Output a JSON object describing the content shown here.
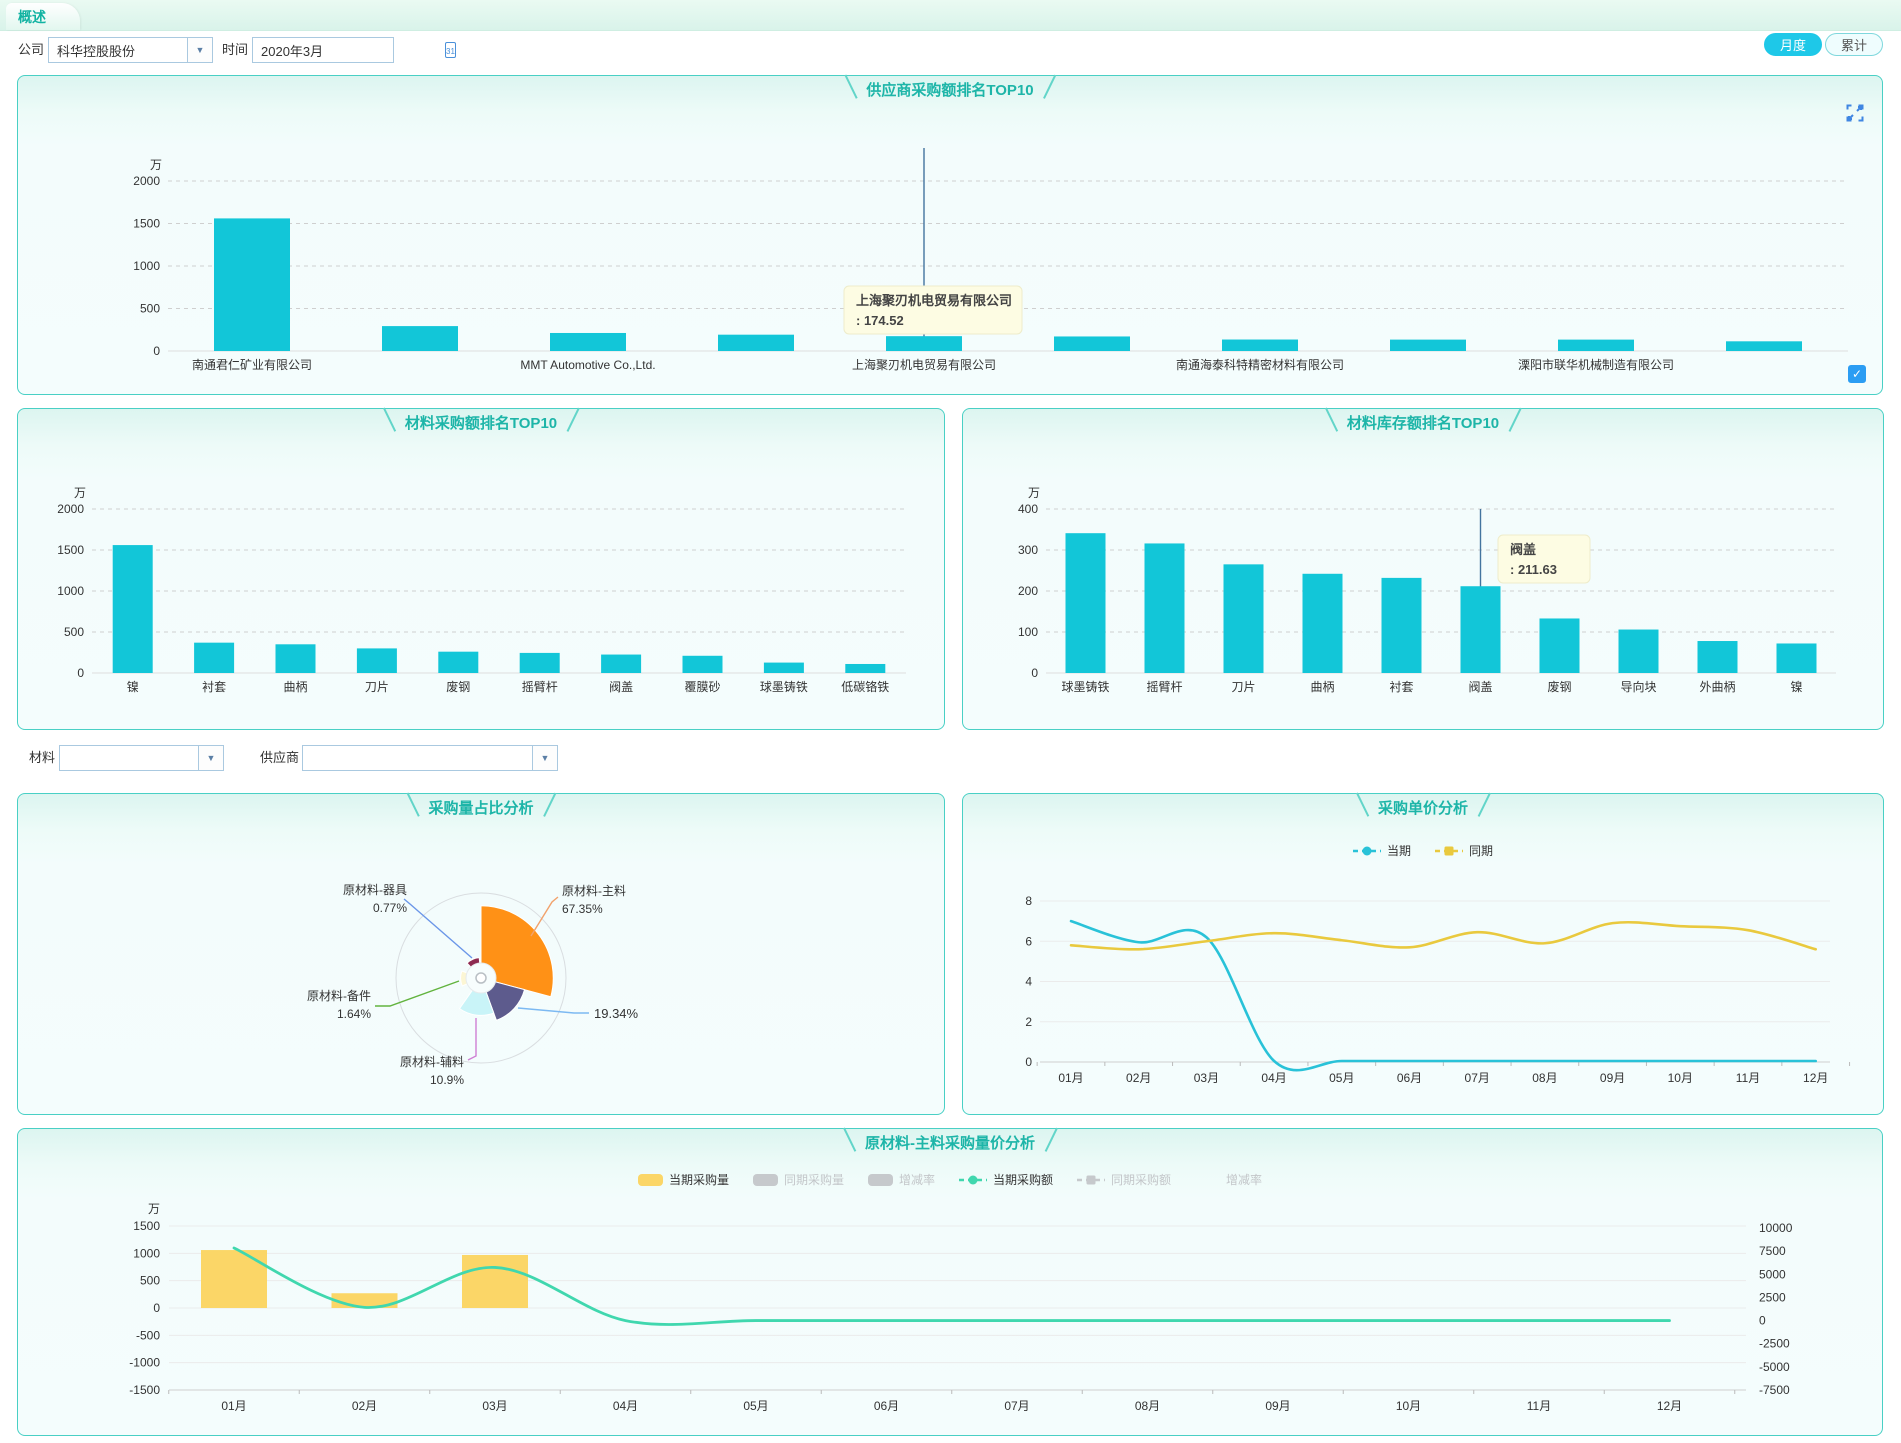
{
  "tab": {
    "label": "概述"
  },
  "filters": {
    "company_label": "公司",
    "company_value": "科华控股股份",
    "time_label": "时间",
    "time_value": "2020年3月",
    "material_label": "材料",
    "material_value": "",
    "supplier_label": "供应商",
    "supplier_value": "",
    "monthly_button": "月度",
    "cumulative_button": "累计"
  },
  "colors": {
    "accent_teal": "#1db5a8",
    "bar_cyan": "#12c6d8",
    "panel_border": "#49d0c5",
    "tooltip_bg": "#fdfce3",
    "axis_pointer": "#43749f",
    "grid_dash": "#cfcfcf",
    "grid_solid": "#ebebeb",
    "axis_text": "#333333",
    "button_active": "#1ec8e8",
    "checkbox_blue": "#2b9df3",
    "expand_blue": "#3f86e2",
    "inactive_gray": "#c6c9cc"
  },
  "chart_data": [
    {
      "id": "supplier_top10",
      "type": "bar",
      "title": "供应商采购额排名TOP10",
      "unit": "万",
      "categories": [
        "南通君仁矿业有限公司",
        "",
        "MMT Automotive Co.,Ltd.",
        "",
        "上海聚刃机电贸易有限公司",
        "",
        "南通海泰科特精密材料有限公司",
        "",
        "溧阳市联华机械制造有限公司",
        ""
      ],
      "values": [
        1560,
        293,
        212,
        192,
        174.52,
        171,
        135,
        134,
        134,
        114
      ],
      "ylim": [
        0,
        2000
      ],
      "ytick_step": 500,
      "grid": "dashed",
      "tooltip": {
        "line1": "上海聚刃机电贸易有限公司",
        "line2": ": 174.52",
        "bar_index": 4
      }
    },
    {
      "id": "material_purchase_top10",
      "type": "bar",
      "title": "材料采购额排名TOP10",
      "unit": "万",
      "categories": [
        "镍",
        "衬套",
        "曲柄",
        "刀片",
        "废钢",
        "摇臂杆",
        "阀盖",
        "覆膜砂",
        "球墨铸铁",
        "低碳铬铁"
      ],
      "values": [
        1560,
        370,
        350,
        300,
        260,
        245,
        225,
        210,
        127,
        110
      ],
      "ylim": [
        0,
        2000
      ],
      "ytick_step": 500,
      "grid": "dashed"
    },
    {
      "id": "material_stock_top10",
      "type": "bar",
      "title": "材料库存额排名TOP10",
      "unit": "万",
      "categories": [
        "球墨铸铁",
        "摇臂杆",
        "刀片",
        "曲柄",
        "衬套",
        "阀盖",
        "废钢",
        "导向块",
        "外曲柄",
        "镍"
      ],
      "values": [
        341,
        316,
        265,
        242,
        232,
        211.63,
        133,
        106,
        78,
        72
      ],
      "ylim": [
        0,
        400
      ],
      "ytick_step": 100,
      "grid": "dashed",
      "tooltip": {
        "line1": "阀盖",
        "line2": ": 211.63",
        "bar_index": 5
      }
    },
    {
      "id": "purchase_qty_share",
      "type": "pie",
      "title": "采购量占比分析",
      "slices": [
        {
          "name": "原材料-主料",
          "pct": "67.35%",
          "color": "#ff9116",
          "line_color": "#f2a26c",
          "start": 0,
          "end": 105,
          "r": 0.85
        },
        {
          "name": "",
          "pct": "19.34%",
          "color": "#5d5b8d",
          "line_color": "#7cb9f2",
          "start": 105,
          "end": 160,
          "r": 0.53
        },
        {
          "name": "原材料-辅料",
          "pct": "10.9%",
          "color": "#c9f4f8",
          "line_color": "#cf7fd4",
          "start": 160,
          "end": 215,
          "r": 0.44
        },
        {
          "name": "原材料-备件",
          "pct": "1.64%",
          "color": "#fcf6d4",
          "line_color": "#62b33e",
          "start": 247,
          "end": 290,
          "r": 0.24
        },
        {
          "name": "原材料-器具",
          "pct": "0.77%",
          "color": "#8e2a50",
          "line_color": "#6b96e8",
          "start": 317,
          "end": 355,
          "r": 0.24
        }
      ]
    },
    {
      "id": "unit_price_analysis",
      "type": "line",
      "title": "采购单价分析",
      "x": [
        "01月",
        "02月",
        "03月",
        "04月",
        "05月",
        "06月",
        "07月",
        "08月",
        "09月",
        "10月",
        "11月",
        "12月"
      ],
      "ylim": [
        0,
        8
      ],
      "ytick_step": 2,
      "legend": [
        {
          "label": "当期",
          "marker": "line-circle",
          "color": "#29c2d8",
          "active": true
        },
        {
          "label": "同期",
          "marker": "line-square",
          "color": "#e9c93e",
          "active": true
        }
      ],
      "series": [
        {
          "name": "当期",
          "color": "#29c2d8",
          "values": [
            7.0,
            5.95,
            6.2,
            0.05,
            0.05,
            0.05,
            0.05,
            0.05,
            0.05,
            0.05,
            0.05,
            0.05
          ]
        },
        {
          "name": "同期",
          "color": "#e9c93e",
          "values": [
            5.8,
            5.6,
            6.0,
            6.4,
            6.05,
            5.7,
            6.45,
            5.9,
            6.9,
            6.75,
            6.55,
            5.6
          ]
        }
      ]
    },
    {
      "id": "main_material_qty_price",
      "type": "bar-line-combo",
      "title": "原材料-主料采购量价分析",
      "x": [
        "01月",
        "02月",
        "03月",
        "04月",
        "05月",
        "06月",
        "07月",
        "08月",
        "09月",
        "10月",
        "11月",
        "12月"
      ],
      "left_axis": {
        "unit": "万",
        "lim": [
          -1500,
          1500
        ],
        "step": 500
      },
      "right_axis": {
        "lim": [
          -7500,
          10000
        ],
        "step": 2500
      },
      "legend": [
        {
          "label": "当期采购量",
          "marker": "bar",
          "color": "#fbd667",
          "active": true
        },
        {
          "label": "同期采购量",
          "marker": "bar",
          "color": "#c6c9cc",
          "active": false
        },
        {
          "label": "增减率",
          "marker": "bar",
          "color": "#c6c9cc",
          "active": false
        },
        {
          "label": "当期采购额",
          "marker": "line-circle",
          "color": "#40d7ae",
          "active": true
        },
        {
          "label": "同期采购额",
          "marker": "line-square",
          "color": "#c6c9cc",
          "active": false
        },
        {
          "label": "增减率",
          "marker": "none",
          "color": "#c6c9cc",
          "active": false
        }
      ],
      "bars": {
        "name": "当期采购量",
        "axis": "left",
        "color": "#fbd667",
        "values": [
          1060,
          270,
          970,
          0,
          0,
          0,
          0,
          0,
          0,
          0,
          0,
          0
        ]
      },
      "line": {
        "name": "当期采购额",
        "axis": "right",
        "color": "#40d7ae",
        "values": [
          7840,
          1430,
          5740,
          0,
          0,
          0,
          0,
          0,
          0,
          0,
          0,
          0
        ]
      }
    }
  ]
}
